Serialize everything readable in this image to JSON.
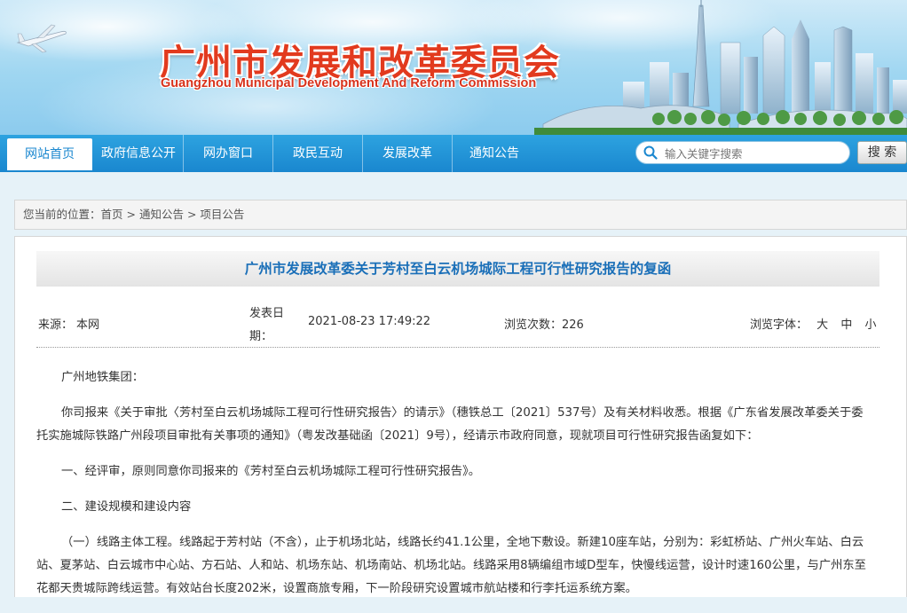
{
  "header": {
    "title_cn": "广州市发展和改革委员会",
    "title_en": "Guangzhou Municipal Development And Reform Commission"
  },
  "nav": {
    "items": [
      {
        "label": "网站首页",
        "active": true
      },
      {
        "label": "政府信息公开"
      },
      {
        "label": "网办窗口"
      },
      {
        "label": "政民互动"
      },
      {
        "label": "发展改革"
      },
      {
        "label": "通知公告"
      }
    ],
    "search_placeholder": "输入关键字搜索",
    "search_button": "搜 索"
  },
  "breadcrumb": {
    "prefix": "您当前的位置：",
    "items": [
      "首页",
      "通知公告",
      "项目公告"
    ],
    "separator": " > "
  },
  "article": {
    "title": "广州市发展改革委关于芳村至白云机场城际工程可行性研究报告的复函",
    "meta": {
      "source_label": "来源：",
      "source": "本网",
      "date_label_line1": "发表日",
      "date_label_line2": "期：",
      "date": "2021-08-23 17:49:22",
      "views_label": "浏览次数：",
      "views": "226",
      "font_label": "浏览字体：",
      "font_sizes": [
        "大",
        "中",
        "小"
      ]
    },
    "paragraphs": [
      "广州地铁集团：",
      "你司报来《关于审批〈芳村至白云机场城际工程可行性研究报告〉的请示》（穗铁总工〔2021〕537号）及有关材料收悉。根据《广东省发展改革委关于委托实施城际铁路广州段项目审批有关事项的通知》（粤发改基础函〔2021〕9号），经请示市政府同意，现就项目可行性研究报告函复如下：",
      "一、经评审，原则同意你司报来的《芳村至白云机场城际工程可行性研究报告》。",
      "二、建设规模和建设内容",
      "（一）线路主体工程。线路起于芳村站（不含），止于机场北站，线路长约41.1公里，全地下敷设。新建10座车站，分别为：彩虹桥站、广州火车站、白云站、夏茅站、白云城市中心站、方石站、人和站、机场东站、机场南站、机场北站。线路采用8辆编组市域D型车，快慢线运营，设计时速160公里，与广州东至花都天贵城际跨线运营。有效站台长度202米，设置商旅专厢，下一阶段研究设置城市航站楼和行李托运系统方案。"
    ]
  },
  "colors": {
    "nav_blue": "#1a87cf",
    "title_blue": "#1a6fb8",
    "logo_red": "#e23a1e"
  }
}
